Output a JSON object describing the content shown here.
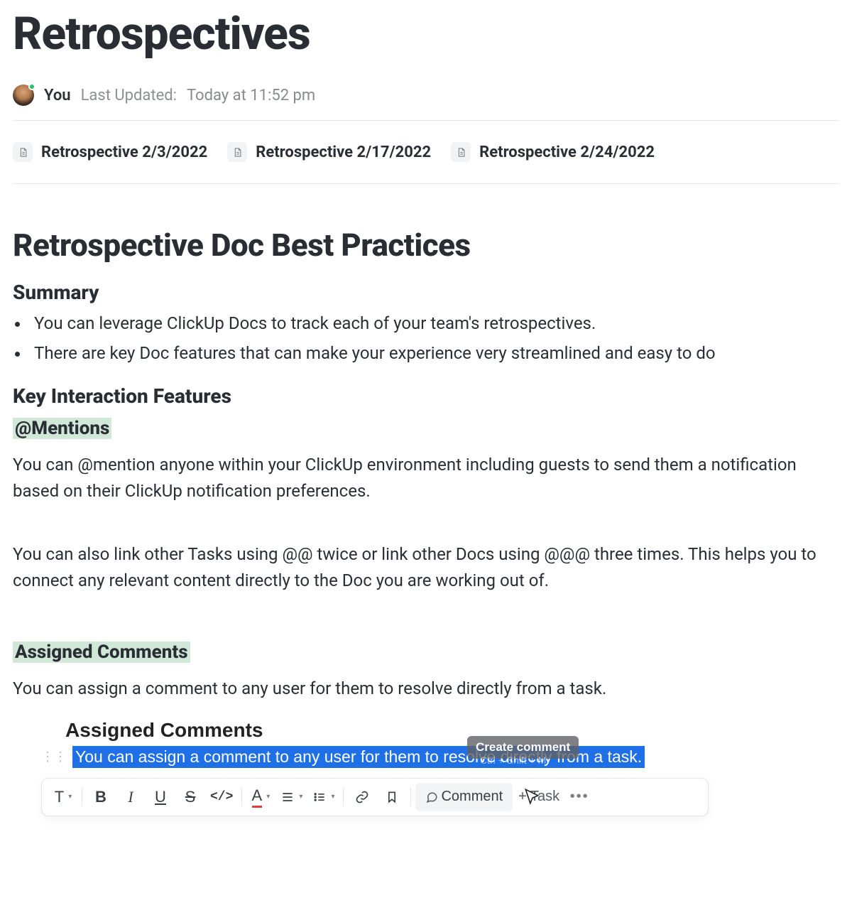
{
  "page": {
    "title": "Retrospectives",
    "author": "You",
    "updated_label": "Last Updated:",
    "updated_value": "Today at 11:52 pm"
  },
  "subpages": [
    {
      "label": "Retrospective 2/3/2022"
    },
    {
      "label": "Retrospective 2/17/2022"
    },
    {
      "label": "Retrospective 2/24/2022"
    }
  ],
  "doc": {
    "section_title": "Retrospective Doc Best Practices",
    "summary_heading": "Summary",
    "summary_bullets": [
      "You can leverage ClickUp Docs to track each of your team's retrospectives.",
      "There are key Doc features that can make your experience very streamlined and easy to do"
    ],
    "key_heading": "Key Interaction Features",
    "mentions_heading": "@Mentions",
    "mentions_p1": "You can @mention anyone within your ClickUp environment including guests to send them a notification based on their ClickUp notification preferences.",
    "mentions_p2": "You can also link other Tasks using @@ twice or link other Docs using @@@ three times.  This helps you to connect any relevant content directly to the Doc you are working out of.",
    "assigned_heading": "Assigned Comments",
    "assigned_p1": "You can assign a comment to any user for them to resolve directly from a task."
  },
  "embed": {
    "title": "Assigned Comments",
    "selected_text": "You can assign a comment to any user for them to resolve directly from a task.",
    "tooltip": "Create comment",
    "tooltip_shortcut": "Ctrl + Shift + M",
    "toolbar": {
      "text": "T",
      "bold": "B",
      "italic": "I",
      "underline": "U",
      "strike": "S",
      "code": "</>",
      "color": "A",
      "comment": "Comment",
      "task": "+ Task",
      "more": "•••"
    }
  }
}
